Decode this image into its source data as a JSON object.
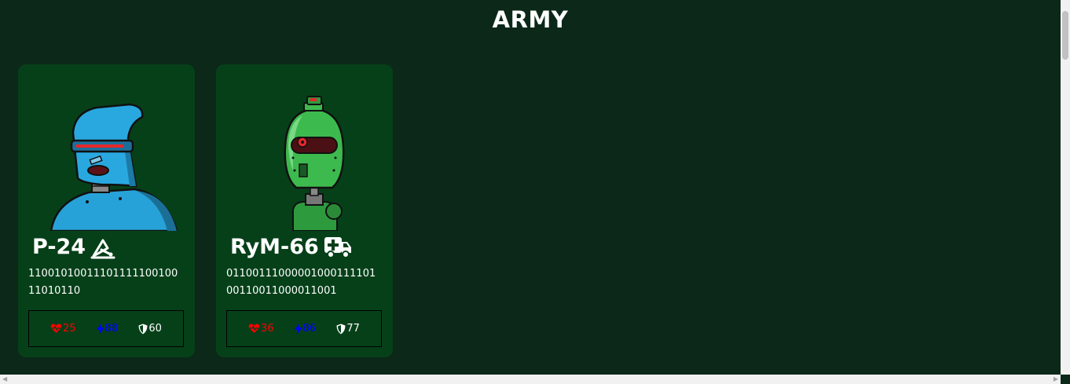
{
  "page": {
    "title": "ARMY"
  },
  "colors": {
    "background": "#0b2818",
    "card": "#064019",
    "hp": "#ff0000",
    "energy": "#0000ff",
    "armor": "#ffffff"
  },
  "robots": [
    {
      "name": "P-24",
      "class_icon": "satellite-dish-icon",
      "dna": "11001010011101111100100 11010110",
      "avatar": "blue-robot-avatar",
      "stats": {
        "hp": "25",
        "energy": "88",
        "armor": "60"
      }
    },
    {
      "name": "RyM-66",
      "class_icon": "ambulance-icon",
      "dna": "01100111000001000111101 00110011000011001",
      "avatar": "green-robot-avatar",
      "stats": {
        "hp": "36",
        "energy": "86",
        "armor": "77"
      }
    }
  ]
}
